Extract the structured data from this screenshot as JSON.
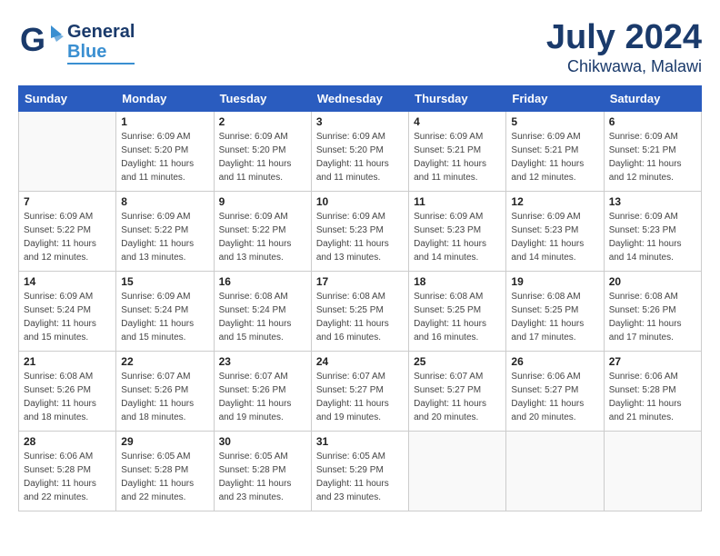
{
  "header": {
    "logo_general": "General",
    "logo_blue": "Blue",
    "title": "July 2024",
    "subtitle": "Chikwawa, Malawi"
  },
  "weekdays": [
    "Sunday",
    "Monday",
    "Tuesday",
    "Wednesday",
    "Thursday",
    "Friday",
    "Saturday"
  ],
  "weeks": [
    [
      {
        "day": "",
        "info": ""
      },
      {
        "day": "1",
        "info": "Sunrise: 6:09 AM\nSunset: 5:20 PM\nDaylight: 11 hours\nand 11 minutes."
      },
      {
        "day": "2",
        "info": "Sunrise: 6:09 AM\nSunset: 5:20 PM\nDaylight: 11 hours\nand 11 minutes."
      },
      {
        "day": "3",
        "info": "Sunrise: 6:09 AM\nSunset: 5:20 PM\nDaylight: 11 hours\nand 11 minutes."
      },
      {
        "day": "4",
        "info": "Sunrise: 6:09 AM\nSunset: 5:21 PM\nDaylight: 11 hours\nand 11 minutes."
      },
      {
        "day": "5",
        "info": "Sunrise: 6:09 AM\nSunset: 5:21 PM\nDaylight: 11 hours\nand 12 minutes."
      },
      {
        "day": "6",
        "info": "Sunrise: 6:09 AM\nSunset: 5:21 PM\nDaylight: 11 hours\nand 12 minutes."
      }
    ],
    [
      {
        "day": "7",
        "info": "Sunrise: 6:09 AM\nSunset: 5:22 PM\nDaylight: 11 hours\nand 12 minutes."
      },
      {
        "day": "8",
        "info": "Sunrise: 6:09 AM\nSunset: 5:22 PM\nDaylight: 11 hours\nand 13 minutes."
      },
      {
        "day": "9",
        "info": "Sunrise: 6:09 AM\nSunset: 5:22 PM\nDaylight: 11 hours\nand 13 minutes."
      },
      {
        "day": "10",
        "info": "Sunrise: 6:09 AM\nSunset: 5:23 PM\nDaylight: 11 hours\nand 13 minutes."
      },
      {
        "day": "11",
        "info": "Sunrise: 6:09 AM\nSunset: 5:23 PM\nDaylight: 11 hours\nand 14 minutes."
      },
      {
        "day": "12",
        "info": "Sunrise: 6:09 AM\nSunset: 5:23 PM\nDaylight: 11 hours\nand 14 minutes."
      },
      {
        "day": "13",
        "info": "Sunrise: 6:09 AM\nSunset: 5:23 PM\nDaylight: 11 hours\nand 14 minutes."
      }
    ],
    [
      {
        "day": "14",
        "info": "Sunrise: 6:09 AM\nSunset: 5:24 PM\nDaylight: 11 hours\nand 15 minutes."
      },
      {
        "day": "15",
        "info": "Sunrise: 6:09 AM\nSunset: 5:24 PM\nDaylight: 11 hours\nand 15 minutes."
      },
      {
        "day": "16",
        "info": "Sunrise: 6:08 AM\nSunset: 5:24 PM\nDaylight: 11 hours\nand 15 minutes."
      },
      {
        "day": "17",
        "info": "Sunrise: 6:08 AM\nSunset: 5:25 PM\nDaylight: 11 hours\nand 16 minutes."
      },
      {
        "day": "18",
        "info": "Sunrise: 6:08 AM\nSunset: 5:25 PM\nDaylight: 11 hours\nand 16 minutes."
      },
      {
        "day": "19",
        "info": "Sunrise: 6:08 AM\nSunset: 5:25 PM\nDaylight: 11 hours\nand 17 minutes."
      },
      {
        "day": "20",
        "info": "Sunrise: 6:08 AM\nSunset: 5:26 PM\nDaylight: 11 hours\nand 17 minutes."
      }
    ],
    [
      {
        "day": "21",
        "info": "Sunrise: 6:08 AM\nSunset: 5:26 PM\nDaylight: 11 hours\nand 18 minutes."
      },
      {
        "day": "22",
        "info": "Sunrise: 6:07 AM\nSunset: 5:26 PM\nDaylight: 11 hours\nand 18 minutes."
      },
      {
        "day": "23",
        "info": "Sunrise: 6:07 AM\nSunset: 5:26 PM\nDaylight: 11 hours\nand 19 minutes."
      },
      {
        "day": "24",
        "info": "Sunrise: 6:07 AM\nSunset: 5:27 PM\nDaylight: 11 hours\nand 19 minutes."
      },
      {
        "day": "25",
        "info": "Sunrise: 6:07 AM\nSunset: 5:27 PM\nDaylight: 11 hours\nand 20 minutes."
      },
      {
        "day": "26",
        "info": "Sunrise: 6:06 AM\nSunset: 5:27 PM\nDaylight: 11 hours\nand 20 minutes."
      },
      {
        "day": "27",
        "info": "Sunrise: 6:06 AM\nSunset: 5:28 PM\nDaylight: 11 hours\nand 21 minutes."
      }
    ],
    [
      {
        "day": "28",
        "info": "Sunrise: 6:06 AM\nSunset: 5:28 PM\nDaylight: 11 hours\nand 22 minutes."
      },
      {
        "day": "29",
        "info": "Sunrise: 6:05 AM\nSunset: 5:28 PM\nDaylight: 11 hours\nand 22 minutes."
      },
      {
        "day": "30",
        "info": "Sunrise: 6:05 AM\nSunset: 5:28 PM\nDaylight: 11 hours\nand 23 minutes."
      },
      {
        "day": "31",
        "info": "Sunrise: 6:05 AM\nSunset: 5:29 PM\nDaylight: 11 hours\nand 23 minutes."
      },
      {
        "day": "",
        "info": ""
      },
      {
        "day": "",
        "info": ""
      },
      {
        "day": "",
        "info": ""
      }
    ]
  ]
}
